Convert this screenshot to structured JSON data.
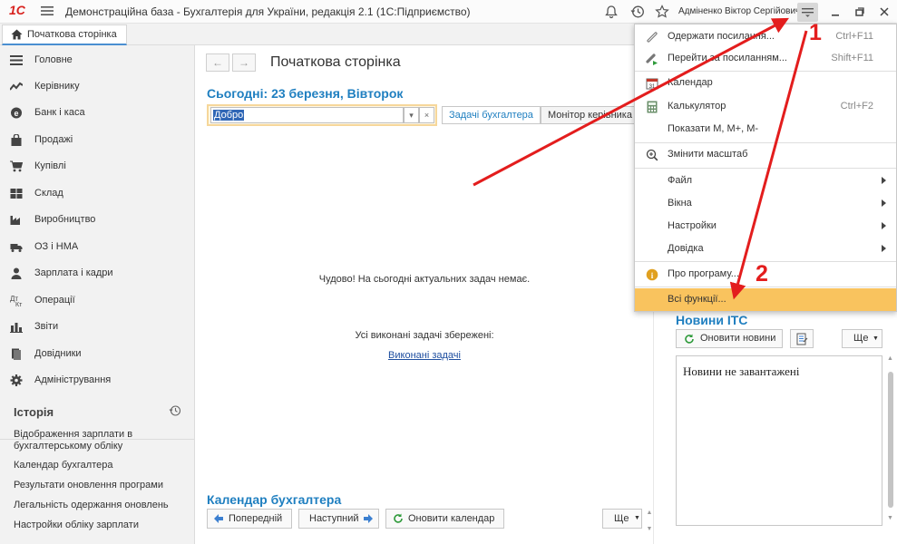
{
  "titlebar": {
    "logo": "1С",
    "title": "Демонстраційна база - Бухгалтерія для України, редакція 2.1  (1С:Підприємство)",
    "user": "Адміненко Віктор Сергійович"
  },
  "tabs": [
    {
      "label": "Початкова сторінка"
    }
  ],
  "sidebar": {
    "items": [
      {
        "label": "Головне",
        "icon": "list-icon"
      },
      {
        "label": "Керівнику",
        "icon": "trend-icon"
      },
      {
        "label": "Банк і каса",
        "icon": "bank-icon"
      },
      {
        "label": "Продажі",
        "icon": "shopping-bag-icon"
      },
      {
        "label": "Купівлі",
        "icon": "cart-icon"
      },
      {
        "label": "Склад",
        "icon": "warehouse-icon"
      },
      {
        "label": "Виробництво",
        "icon": "factory-icon"
      },
      {
        "label": "ОЗ і НМА",
        "icon": "truck-icon"
      },
      {
        "label": "Зарплата і кадри",
        "icon": "person-icon"
      },
      {
        "label": "Операції",
        "icon": "operations-icon"
      },
      {
        "label": "Звіти",
        "icon": "bar-chart-icon"
      },
      {
        "label": "Довідники",
        "icon": "books-icon"
      },
      {
        "label": "Адміністрування",
        "icon": "gear-icon"
      }
    ],
    "history": {
      "title": "Історія",
      "items": [
        "Відображення зарплати в бухгалтерському обліку",
        "Календар бухгалтера",
        "Результати оновлення програми",
        "Легальність одержання оновлень",
        "Настройки обліку зарплати"
      ]
    }
  },
  "main": {
    "nav_back": "←",
    "nav_forward": "→",
    "title": "Початкова сторінка",
    "today": "Сьогодні: 23 березня, Вівторок",
    "filter_value": "Добро",
    "dropdown_glyph": "▾",
    "clear_glyph": "×",
    "task_tabs": [
      "Задачі бухгалтера",
      "Монітор керівника"
    ],
    "no_tasks": "Чудово! На сьогодні актуальних задач немає.",
    "saved": "Усі виконані задачі збережені:",
    "done_link": "Виконані задачі",
    "calendar": {
      "title": "Календар бухгалтера",
      "prev": "Попередній",
      "next": "Наступний",
      "refresh": "Оновити календар",
      "more": "Ще"
    }
  },
  "news": {
    "title": "Новини ITC",
    "refresh": "Оновити новини",
    "more": "Ще",
    "empty": "Новини не завантажені"
  },
  "menu": {
    "items": [
      {
        "label": "Одержати посилання...",
        "shortcut": "Ctrl+F11",
        "icon": "link-icon"
      },
      {
        "label": "Перейти за посиланням...",
        "shortcut": "Shift+F11",
        "icon": "follow-link-icon"
      },
      {
        "label": "Календар",
        "shortcut": "",
        "icon": "calendar-icon"
      },
      {
        "label": "Калькулятор",
        "shortcut": "Ctrl+F2",
        "icon": "calculator-icon"
      },
      {
        "label": "Показати М, М+, М-",
        "shortcut": "",
        "icon": ""
      },
      {
        "label": "Змінити масштаб",
        "shortcut": "",
        "icon": "zoom-icon"
      },
      {
        "label": "Файл",
        "shortcut": "",
        "icon": ""
      },
      {
        "label": "Вікна",
        "shortcut": "",
        "icon": ""
      },
      {
        "label": "Настройки",
        "shortcut": "",
        "icon": ""
      },
      {
        "label": "Довідка",
        "shortcut": "",
        "icon": ""
      },
      {
        "label": "Про програму...",
        "shortcut": "",
        "icon": "info-icon"
      },
      {
        "label": "Всі функції...",
        "shortcut": "",
        "icon": ""
      }
    ]
  },
  "annotations": {
    "step1": "1",
    "step2": "2",
    "color": "#e31d1d"
  }
}
